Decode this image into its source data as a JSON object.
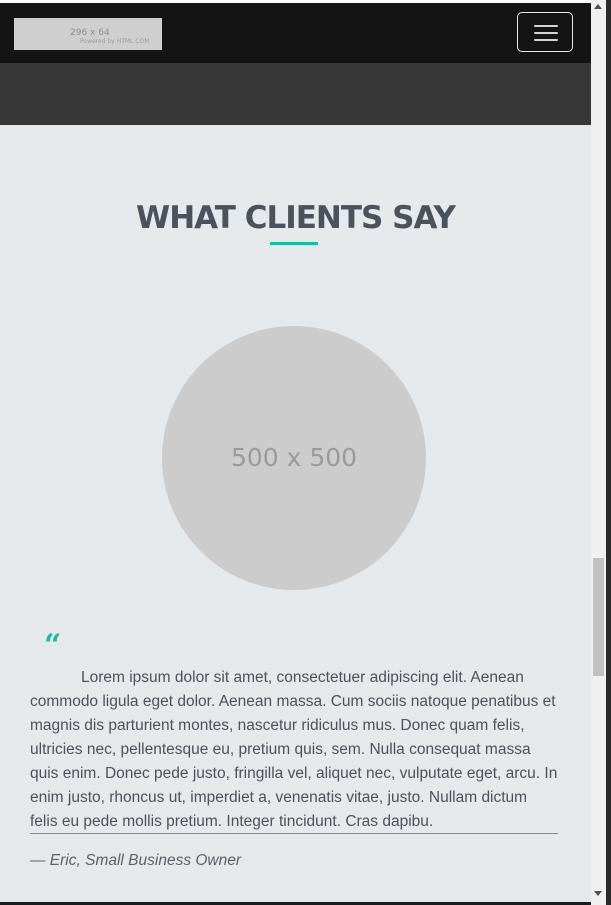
{
  "logo": {
    "dims": "296 x 64",
    "powered": "Powered by HTML.COM"
  },
  "navbar": {
    "toggle_icon": "hamburger-menu-icon"
  },
  "section": {
    "title": "WHAT CLIENTS SAY",
    "avatar_placeholder": "500 x 500"
  },
  "testimonial": {
    "quote_icon": "“",
    "text": "Lorem ipsum dolor sit amet, consectetuer adipiscing elit. Aenean commodo ligula eget dolor. Aenean massa. Cum sociis natoque penatibus et magnis dis parturient montes, nascetur ridiculus mus. Donec quam felis, ultricies nec, pellentesque eu, pretium quis, sem. Nulla consequat massa quis enim. Donec pede justo, fringilla vel, aliquet nec, vulputate eget, arcu. In enim justo, rhoncus ut, imperdiet a, venenatis vitae, justo. Nullam dictum felis eu pede mollis pretium. Integer tincidunt. Cras dapibu.",
    "author": "— Eric, Small Business Owner"
  },
  "colors": {
    "accent": "#1abc9c",
    "navbar": "#141414",
    "heading": "#4a525b",
    "section_bg": "#e6e9ec"
  }
}
